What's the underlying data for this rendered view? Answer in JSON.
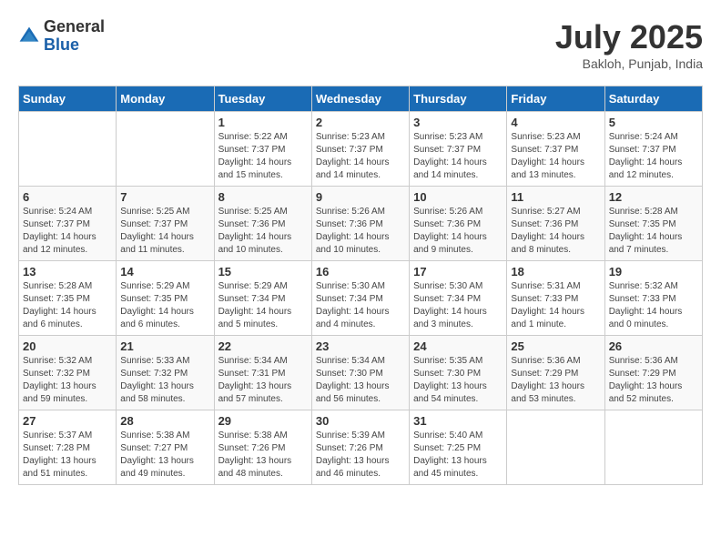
{
  "header": {
    "logo_general": "General",
    "logo_blue": "Blue",
    "month_title": "July 2025",
    "location": "Bakloh, Punjab, India"
  },
  "weekdays": [
    "Sunday",
    "Monday",
    "Tuesday",
    "Wednesday",
    "Thursday",
    "Friday",
    "Saturday"
  ],
  "weeks": [
    [
      {
        "day": "",
        "info": ""
      },
      {
        "day": "",
        "info": ""
      },
      {
        "day": "1",
        "info": "Sunrise: 5:22 AM\nSunset: 7:37 PM\nDaylight: 14 hours and 15 minutes."
      },
      {
        "day": "2",
        "info": "Sunrise: 5:23 AM\nSunset: 7:37 PM\nDaylight: 14 hours and 14 minutes."
      },
      {
        "day": "3",
        "info": "Sunrise: 5:23 AM\nSunset: 7:37 PM\nDaylight: 14 hours and 14 minutes."
      },
      {
        "day": "4",
        "info": "Sunrise: 5:23 AM\nSunset: 7:37 PM\nDaylight: 14 hours and 13 minutes."
      },
      {
        "day": "5",
        "info": "Sunrise: 5:24 AM\nSunset: 7:37 PM\nDaylight: 14 hours and 12 minutes."
      }
    ],
    [
      {
        "day": "6",
        "info": "Sunrise: 5:24 AM\nSunset: 7:37 PM\nDaylight: 14 hours and 12 minutes."
      },
      {
        "day": "7",
        "info": "Sunrise: 5:25 AM\nSunset: 7:37 PM\nDaylight: 14 hours and 11 minutes."
      },
      {
        "day": "8",
        "info": "Sunrise: 5:25 AM\nSunset: 7:36 PM\nDaylight: 14 hours and 10 minutes."
      },
      {
        "day": "9",
        "info": "Sunrise: 5:26 AM\nSunset: 7:36 PM\nDaylight: 14 hours and 10 minutes."
      },
      {
        "day": "10",
        "info": "Sunrise: 5:26 AM\nSunset: 7:36 PM\nDaylight: 14 hours and 9 minutes."
      },
      {
        "day": "11",
        "info": "Sunrise: 5:27 AM\nSunset: 7:36 PM\nDaylight: 14 hours and 8 minutes."
      },
      {
        "day": "12",
        "info": "Sunrise: 5:28 AM\nSunset: 7:35 PM\nDaylight: 14 hours and 7 minutes."
      }
    ],
    [
      {
        "day": "13",
        "info": "Sunrise: 5:28 AM\nSunset: 7:35 PM\nDaylight: 14 hours and 6 minutes."
      },
      {
        "day": "14",
        "info": "Sunrise: 5:29 AM\nSunset: 7:35 PM\nDaylight: 14 hours and 6 minutes."
      },
      {
        "day": "15",
        "info": "Sunrise: 5:29 AM\nSunset: 7:34 PM\nDaylight: 14 hours and 5 minutes."
      },
      {
        "day": "16",
        "info": "Sunrise: 5:30 AM\nSunset: 7:34 PM\nDaylight: 14 hours and 4 minutes."
      },
      {
        "day": "17",
        "info": "Sunrise: 5:30 AM\nSunset: 7:34 PM\nDaylight: 14 hours and 3 minutes."
      },
      {
        "day": "18",
        "info": "Sunrise: 5:31 AM\nSunset: 7:33 PM\nDaylight: 14 hours and 1 minute."
      },
      {
        "day": "19",
        "info": "Sunrise: 5:32 AM\nSunset: 7:33 PM\nDaylight: 14 hours and 0 minutes."
      }
    ],
    [
      {
        "day": "20",
        "info": "Sunrise: 5:32 AM\nSunset: 7:32 PM\nDaylight: 13 hours and 59 minutes."
      },
      {
        "day": "21",
        "info": "Sunrise: 5:33 AM\nSunset: 7:32 PM\nDaylight: 13 hours and 58 minutes."
      },
      {
        "day": "22",
        "info": "Sunrise: 5:34 AM\nSunset: 7:31 PM\nDaylight: 13 hours and 57 minutes."
      },
      {
        "day": "23",
        "info": "Sunrise: 5:34 AM\nSunset: 7:30 PM\nDaylight: 13 hours and 56 minutes."
      },
      {
        "day": "24",
        "info": "Sunrise: 5:35 AM\nSunset: 7:30 PM\nDaylight: 13 hours and 54 minutes."
      },
      {
        "day": "25",
        "info": "Sunrise: 5:36 AM\nSunset: 7:29 PM\nDaylight: 13 hours and 53 minutes."
      },
      {
        "day": "26",
        "info": "Sunrise: 5:36 AM\nSunset: 7:29 PM\nDaylight: 13 hours and 52 minutes."
      }
    ],
    [
      {
        "day": "27",
        "info": "Sunrise: 5:37 AM\nSunset: 7:28 PM\nDaylight: 13 hours and 51 minutes."
      },
      {
        "day": "28",
        "info": "Sunrise: 5:38 AM\nSunset: 7:27 PM\nDaylight: 13 hours and 49 minutes."
      },
      {
        "day": "29",
        "info": "Sunrise: 5:38 AM\nSunset: 7:26 PM\nDaylight: 13 hours and 48 minutes."
      },
      {
        "day": "30",
        "info": "Sunrise: 5:39 AM\nSunset: 7:26 PM\nDaylight: 13 hours and 46 minutes."
      },
      {
        "day": "31",
        "info": "Sunrise: 5:40 AM\nSunset: 7:25 PM\nDaylight: 13 hours and 45 minutes."
      },
      {
        "day": "",
        "info": ""
      },
      {
        "day": "",
        "info": ""
      }
    ]
  ]
}
